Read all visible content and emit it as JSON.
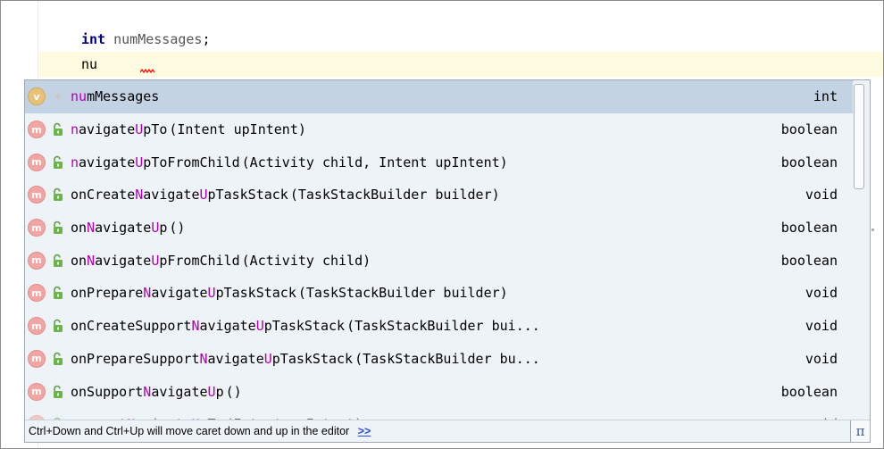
{
  "editor": {
    "declaration": {
      "keyword": "int",
      "identifier": "numMessages",
      "terminator": ";"
    },
    "typed_text": "nu"
  },
  "completion": {
    "items": [
      {
        "kind": "v",
        "visibility": "field",
        "pre": "",
        "hl": "nu",
        "post": "mMessages",
        "args": "",
        "type": "int",
        "selected": true
      },
      {
        "kind": "m",
        "visibility": "public",
        "pre": "",
        "hl": "n",
        "post": "avigate",
        "hl2": "U",
        "post2": "pTo",
        "args": " (Intent upIntent)",
        "type": "boolean"
      },
      {
        "kind": "m",
        "visibility": "public",
        "pre": "",
        "hl": "n",
        "post": "avigate",
        "hl2": "U",
        "post2": "pToFromChild",
        "args": " (Activity child, Intent upIntent)",
        "type": "boolean"
      },
      {
        "kind": "m",
        "visibility": "public",
        "pre": "onCreate",
        "hl": "N",
        "post": "avigate",
        "hl2": "U",
        "post2": "pTaskStack",
        "args": " (TaskStackBuilder builder)",
        "type": "void"
      },
      {
        "kind": "m",
        "visibility": "public",
        "pre": "on",
        "hl": "N",
        "post": "avigate",
        "hl2": "U",
        "post2": "p",
        "args": " ()",
        "type": "boolean"
      },
      {
        "kind": "m",
        "visibility": "public",
        "pre": "on",
        "hl": "N",
        "post": "avigate",
        "hl2": "U",
        "post2": "pFromChild",
        "args": " (Activity child)",
        "type": "boolean"
      },
      {
        "kind": "m",
        "visibility": "public",
        "pre": "onPrepare",
        "hl": "N",
        "post": "avigate",
        "hl2": "U",
        "post2": "pTaskStack",
        "args": " (TaskStackBuilder builder)",
        "type": "void"
      },
      {
        "kind": "m",
        "visibility": "public",
        "pre": "onCreateSupport",
        "hl": "N",
        "post": "avigate",
        "hl2": "U",
        "post2": "pTaskStack",
        "args": " (TaskStackBuilder bui...",
        "type": "void"
      },
      {
        "kind": "m",
        "visibility": "public",
        "pre": "onPrepareSupport",
        "hl": "N",
        "post": "avigate",
        "hl2": "U",
        "post2": "pTaskStack",
        "args": " (TaskStackBuilder bu...",
        "type": "void"
      },
      {
        "kind": "m",
        "visibility": "public",
        "pre": "onSupport",
        "hl": "N",
        "post": "avigate",
        "hl2": "U",
        "post2": "p",
        "args": " ()",
        "type": "boolean"
      },
      {
        "kind": "m",
        "visibility": "public",
        "pre": "support",
        "hl": "N",
        "post": "avigate",
        "hl2": "U",
        "post2": "pTo",
        "args": " (Intent upIntent)",
        "type": "void",
        "cut": true
      }
    ],
    "footer_hint": "Ctrl+Down and Ctrl+Up will move caret down and up in the editor",
    "footer_link": ">>",
    "pi_label": "π"
  },
  "colors": {
    "selection": "#c4d3e3",
    "popup_bg": "#eef3f8",
    "match_highlight": "#b200b2",
    "keyword": "#000080",
    "current_line": "#fffbe0",
    "error_squiggle": "#ff0000"
  },
  "icons": {
    "method": "method-icon",
    "variable": "variable-icon",
    "public": "unlocked-visibility-icon",
    "field": "field-dot-icon"
  }
}
